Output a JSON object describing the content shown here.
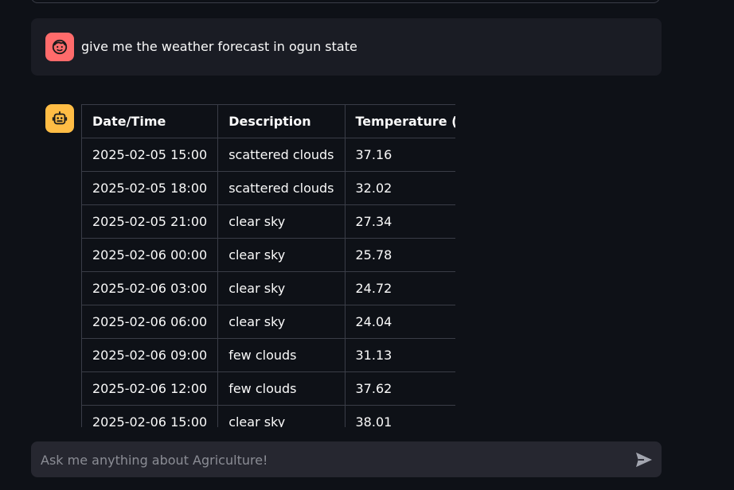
{
  "chat": {
    "user_message": "give me the weather forecast in ogun state",
    "user_avatar_icon": "smiley-face-icon",
    "bot_avatar_icon": "robot-icon",
    "colors": {
      "background": "#0e1117",
      "user_bubble": "#1a1c24",
      "user_avatar": "#ff6b6b",
      "bot_avatar": "#ffbd45",
      "input_bg": "#262730"
    }
  },
  "forecast_table": {
    "headers": [
      "Date/Time",
      "Description",
      "Temperature (°C)"
    ],
    "rows": [
      [
        "2025-02-05 15:00",
        "scattered clouds",
        "37.16"
      ],
      [
        "2025-02-05 18:00",
        "scattered clouds",
        "32.02"
      ],
      [
        "2025-02-05 21:00",
        "clear sky",
        "27.34"
      ],
      [
        "2025-02-06 00:00",
        "clear sky",
        "25.78"
      ],
      [
        "2025-02-06 03:00",
        "clear sky",
        "24.72"
      ],
      [
        "2025-02-06 06:00",
        "clear sky",
        "24.04"
      ],
      [
        "2025-02-06 09:00",
        "few clouds",
        "31.13"
      ],
      [
        "2025-02-06 12:00",
        "few clouds",
        "37.62"
      ],
      [
        "2025-02-06 15:00",
        "clear sky",
        "38.01"
      ]
    ]
  },
  "input": {
    "placeholder": "Ask me anything about Agriculture!",
    "value": "",
    "send_icon": "send-icon"
  }
}
